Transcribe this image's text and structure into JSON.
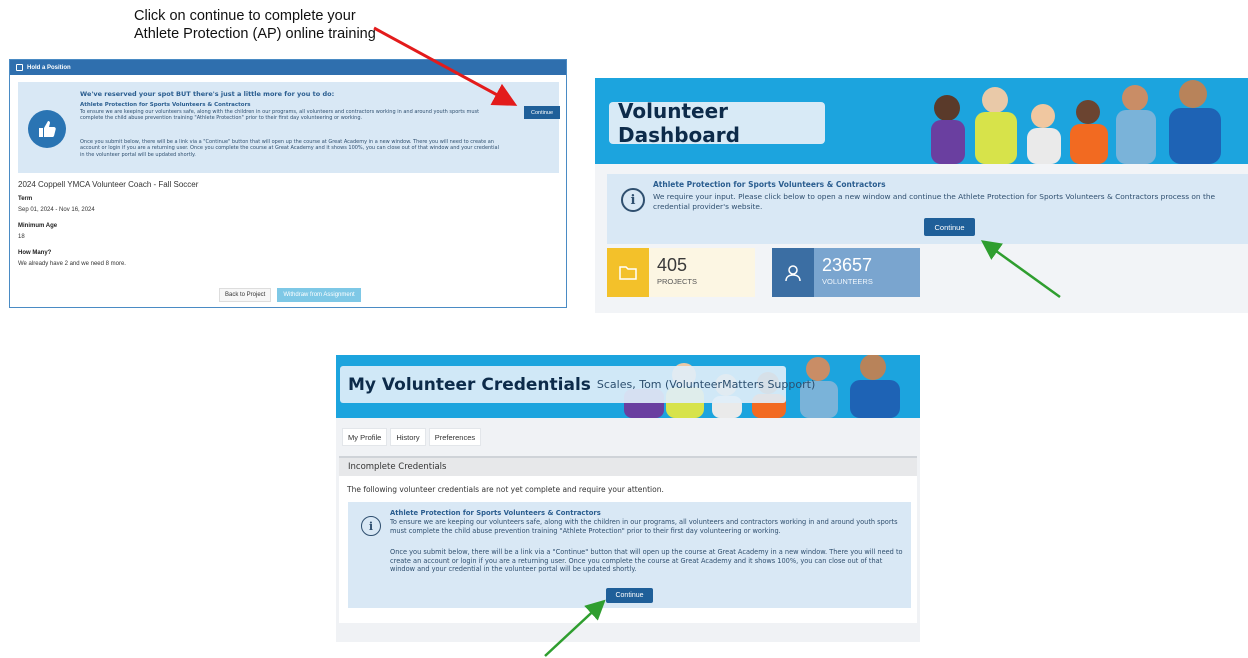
{
  "callout": {
    "line1": "Click on continue to complete your",
    "line2": "Athlete Protection (AP) online training"
  },
  "colors": {
    "brand_blue": "#1ca4de",
    "dark_navy": "#0d2b4a",
    "alert_bg": "#d9e8f5",
    "button_blue": "#1f5f99",
    "red_arrow": "#e31b1b",
    "green_arrow": "#2f9e2f",
    "stat_yellow": "#f3c12a",
    "stat_blue": "#3b6ea3"
  },
  "hold_position": {
    "header": "Hold a Position",
    "header_icon": "calendar-plus-icon",
    "alert_icon": "thumbs-up-icon",
    "alert_lead": "We've reserved your spot BUT there's just a little more for you to do:",
    "alert_title": "Athlete Protection for Sports Volunteers & Contractors",
    "alert_p1": "To ensure we are keeping our volunteers safe, along with the children in our programs, all volunteers and contractors working in and around youth sports must complete the child abuse prevention training \"Athlete Protection\" prior to their first day volunteering or working.",
    "alert_p2": "Once you submit below, there will be a link via a \"Continue\" button that will open up the course at Great Academy in a new window. There you will need to create an account or login if you are a returning user. Once you complete the course at Great Academy and it shows 100%, you can close out of that window and your credential in the volunteer portal will be updated shortly.",
    "continue_label": "Continue",
    "role_title": "2024 Coppell YMCA Volunteer Coach - Fall Soccer",
    "term_label": "Term",
    "term_value": "Sep 01, 2024 - Nov 16, 2024",
    "min_age_label": "Minimum Age",
    "min_age_value": "18",
    "how_many_label": "How Many?",
    "how_many_value": "We already have 2 and we need 8 more.",
    "back_button": "Back to Project",
    "withdraw_button": "Withdraw from Assignment"
  },
  "dashboard": {
    "title": "Volunteer Dashboard",
    "alert_icon": "info-icon",
    "alert_title": "Athlete Protection for Sports Volunteers & Contractors",
    "alert_text": "We require your input. Please click below to open a new window and continue the Athlete Protection for Sports Volunteers & Contractors process on the credential provider's website.",
    "continue_label": "Continue",
    "stats": [
      {
        "value": "405",
        "label": "PROJECTS",
        "icon": "folder-icon"
      },
      {
        "value": "23657",
        "label": "VOLUNTEERS",
        "icon": "volunteer-icon"
      }
    ]
  },
  "credentials": {
    "title": "My Volunteer Credentials",
    "subtitle": "Scales, Tom (VolunteerMatters Support)",
    "tabs": [
      "My Profile",
      "History",
      "Preferences"
    ],
    "section_title": "Incomplete Credentials",
    "intro": "The following volunteer credentials are not yet complete and require your attention.",
    "alert_icon": "info-icon",
    "alert_title": "Athlete Protection for Sports Volunteers & Contractors",
    "alert_p1": "To ensure we are keeping our volunteers safe, along with the children in our programs, all volunteers and contractors working in and around youth sports must complete the child abuse prevention training \"Athlete Protection\" prior to their first day volunteering or working.",
    "alert_p2": "Once you submit below, there will be a link via a \"Continue\" button that will open up the course at Great Academy in a new window. There you will need to create an account or login if you are a returning user. Once you complete the course at Great Academy and it shows 100%, you can close out of that window and your credential in the volunteer portal will be updated shortly.",
    "continue_label": "Continue"
  }
}
